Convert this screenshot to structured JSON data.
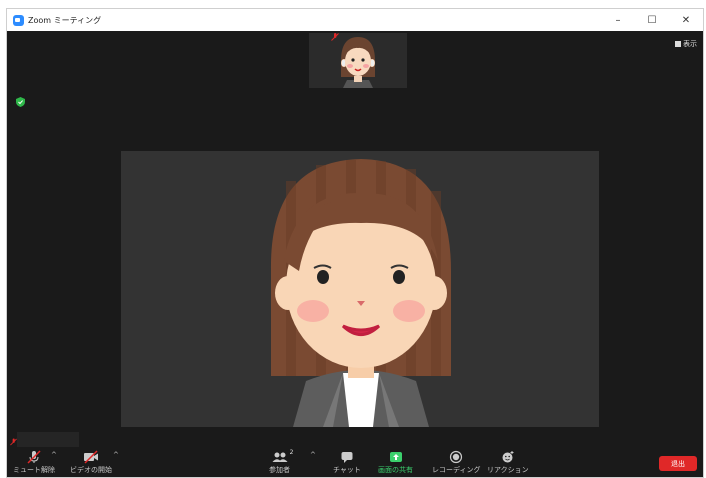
{
  "window": {
    "title": "Zoom ミーティング"
  },
  "topbar": {
    "view_label": "表示"
  },
  "participants_count": "2",
  "toolbar": {
    "unmute_label": "ミュート解除",
    "start_video_label": "ビデオの開始",
    "participants_label": "参加者",
    "chat_label": "チャット",
    "share_label": "画面の共有",
    "record_label": "レコーディング",
    "reactions_label": "リアクション",
    "leave_label": "退出"
  },
  "colors": {
    "share_green": "#3bd06d",
    "leave_red": "#e02828",
    "shield_green": "#2fb84a",
    "mute_red": "#e02828"
  }
}
